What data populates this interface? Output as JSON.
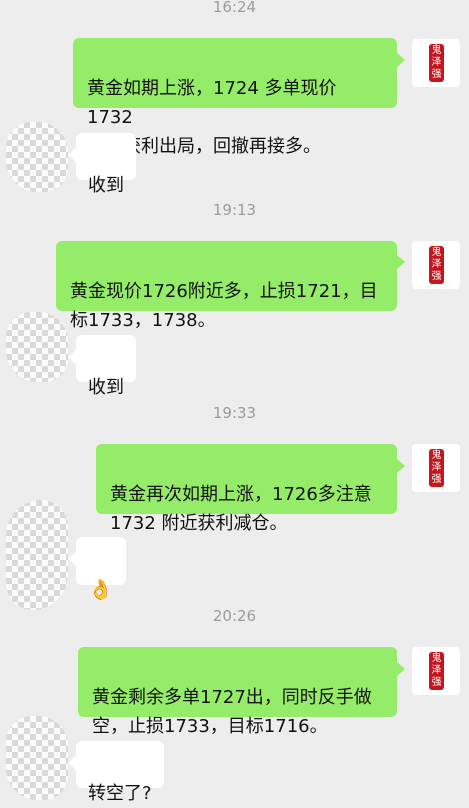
{
  "timestamps": [
    "16:24",
    "19:13",
    "19:33",
    "20:26"
  ],
  "messages": [
    {
      "side": "right",
      "text": "黄金如期上涨，1724 多单现价 1732\n一线获利出局，回撤再接多。"
    },
    {
      "side": "left",
      "text": "收到"
    },
    {
      "side": "right",
      "text": "黄金现价1726附近多，止损1721，目\n标1733，1738。"
    },
    {
      "side": "left",
      "text": "收到"
    },
    {
      "side": "right",
      "text": "黄金再次如期上涨，1726多注意\n1732 附近获利减仓。"
    },
    {
      "side": "left",
      "text": "👌",
      "icon": "ok-hand-emoji"
    },
    {
      "side": "right",
      "text": "黄金剩余多单1727出，同时反手做\n空，止损1733，目标1716。"
    },
    {
      "side": "left",
      "text": "转空了?"
    }
  ],
  "contact_avatar": {
    "seal_text": "鬼泽强",
    "seal_color": "#c4161c"
  },
  "colors": {
    "background": "#ededed",
    "outgoing_bubble": "#95ec69",
    "incoming_bubble": "#ffffff",
    "timestamp_text": "#9b9b9b"
  }
}
